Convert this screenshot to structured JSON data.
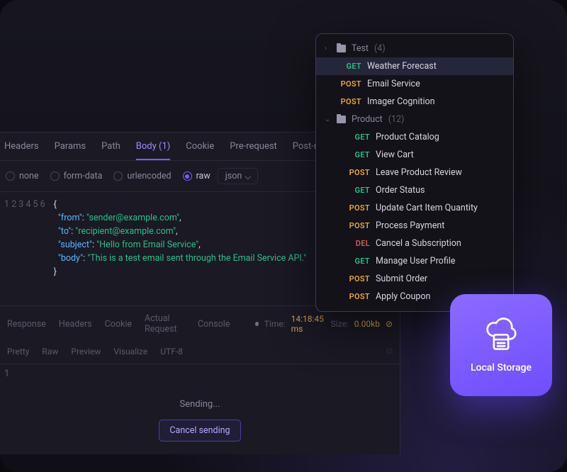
{
  "tabs": {
    "headers": "Headers",
    "params": "Params",
    "path": "Path",
    "body": "Body",
    "body_count": "(1)",
    "cookie": "Cookie",
    "pre": "Pre-request",
    "post": "Post-response"
  },
  "body_types": {
    "none": "none",
    "formdata": "form-data",
    "urlencoded": "urlencoded",
    "raw": "raw",
    "format": "json"
  },
  "code": {
    "lines": [
      "1",
      "2",
      "3",
      "4",
      "5",
      "6"
    ],
    "open": "{",
    "close": "}",
    "entries": [
      {
        "key": "\"from\"",
        "sep": ": ",
        "val": "\"sender@example.com\"",
        "trail": ","
      },
      {
        "key": "\"to\"",
        "sep": ": ",
        "val": "\"recipient@example.com\"",
        "trail": ","
      },
      {
        "key": "\"subject\"",
        "sep": ": ",
        "val": "\"Hello from Email Service\"",
        "trail": ","
      },
      {
        "key": "\"body\"",
        "sep": ": ",
        "val": "\"This is a test email sent through the Email Service API.\"",
        "trail": ""
      }
    ]
  },
  "response": {
    "tabs": {
      "response": "Response",
      "headers": "Headers",
      "cookie": "Cookie",
      "actual": "Actual Request",
      "console": "Console"
    },
    "time_label": "Time:",
    "time_value": "14:18:45 ms",
    "size_label": "Size:",
    "size_value": "0.00kb",
    "sub": {
      "pretty": "Pretty",
      "raw": "Raw",
      "preview": "Preview",
      "visual": "Visualize",
      "enc": "UTF-8"
    },
    "line1": "1",
    "sending": "Sending...",
    "cancel": "Cancel sending"
  },
  "tree": {
    "folders": [
      {
        "name": "Test",
        "count": "(4)",
        "expanded": false,
        "arrow": "›",
        "items": [
          {
            "method": "GET",
            "cls": "m-get",
            "name": "Weather Forecast",
            "selected": true
          },
          {
            "method": "POST",
            "cls": "m-post",
            "name": "Email Service"
          },
          {
            "method": "POST",
            "cls": "m-post",
            "name": "Imager Cognition"
          }
        ]
      },
      {
        "name": "Product",
        "count": "(12)",
        "expanded": true,
        "arrow": "⌄",
        "items": [
          {
            "method": "GET",
            "cls": "m-get",
            "name": "Product Catalog"
          },
          {
            "method": "GET",
            "cls": "m-get",
            "name": "View Cart"
          },
          {
            "method": "POST",
            "cls": "m-post",
            "name": "Leave Product Review"
          },
          {
            "method": "GET",
            "cls": "m-get",
            "name": "Order Status"
          },
          {
            "method": "POST",
            "cls": "m-post",
            "name": "Update Cart Item Quantity"
          },
          {
            "method": "POST",
            "cls": "m-post",
            "name": "Process Payment"
          },
          {
            "method": "DEL",
            "cls": "m-del",
            "name": "Cancel a Subscription"
          },
          {
            "method": "GET",
            "cls": "m-get",
            "name": "Manage User Profile"
          },
          {
            "method": "POST",
            "cls": "m-post",
            "name": "Submit Order"
          },
          {
            "method": "POST",
            "cls": "m-post",
            "name": "Apply Coupon"
          }
        ]
      }
    ]
  },
  "card": {
    "label": "Local Storage"
  }
}
